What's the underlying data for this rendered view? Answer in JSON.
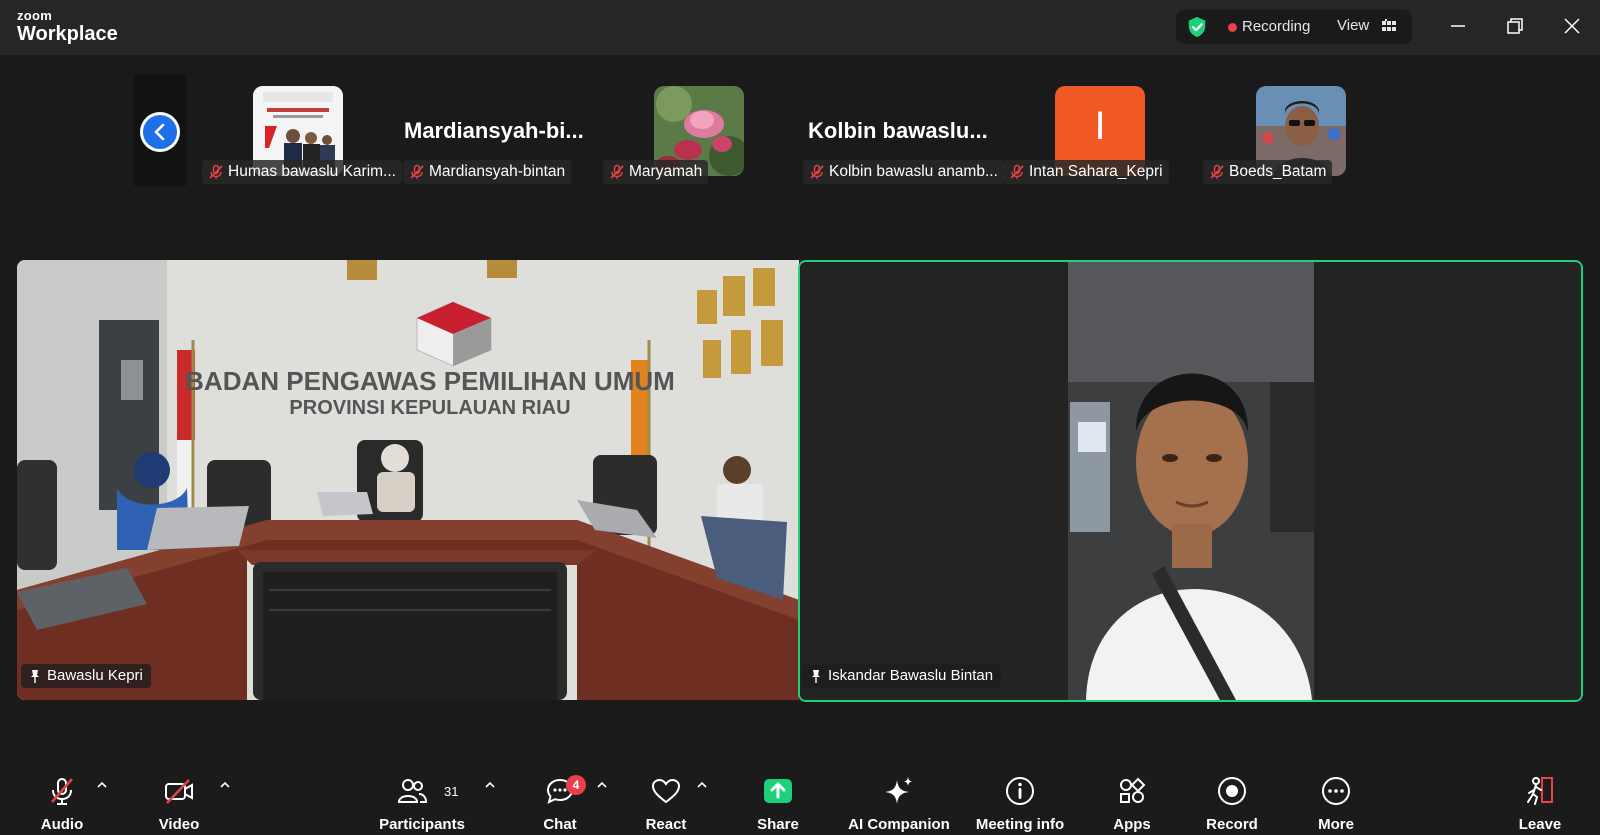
{
  "app": {
    "brand_small": "zoom",
    "brand_big": "Workplace"
  },
  "titlebar": {
    "recording_label": "Recording",
    "view_label": "View"
  },
  "strip": {
    "items": [
      {
        "name": "Humas bawaslu Karim...",
        "kind": "photo"
      },
      {
        "name": "Mardiansyah-bintan",
        "display": "Mardiansyah-bi..."
      },
      {
        "name": "Maryamah",
        "kind": "photo"
      },
      {
        "name": "Kolbin bawaslu anamb...",
        "display": "Kolbin  bawaslu..."
      },
      {
        "name": "Intan Sahara_Kepri",
        "initial": "I"
      },
      {
        "name": "Boeds_Batam",
        "kind": "photo"
      }
    ]
  },
  "tiles": {
    "left": {
      "name": "Bawaslu Kepri",
      "wall_line1": "BADAN PENGAWAS PEMILIHAN UMUM",
      "wall_line2": "PROVINSI KEPULAUAN RIAU"
    },
    "right": {
      "name": "Iskandar Bawaslu Bintan"
    }
  },
  "toolbar": {
    "audio": "Audio",
    "video": "Video",
    "participants": "Participants",
    "participants_count": "31",
    "chat": "Chat",
    "chat_badge": "4",
    "react": "React",
    "share": "Share",
    "ai_companion": "AI Companion",
    "meeting_info": "Meeting info",
    "apps": "Apps",
    "record": "Record",
    "more": "More",
    "leave": "Leave"
  },
  "colors": {
    "active_speaker": "#1dd07a",
    "share_green": "#1dd07a",
    "badge_red": "#e8414a",
    "back_blue": "#1e6fe8",
    "initial_tile": "#f15a24"
  }
}
